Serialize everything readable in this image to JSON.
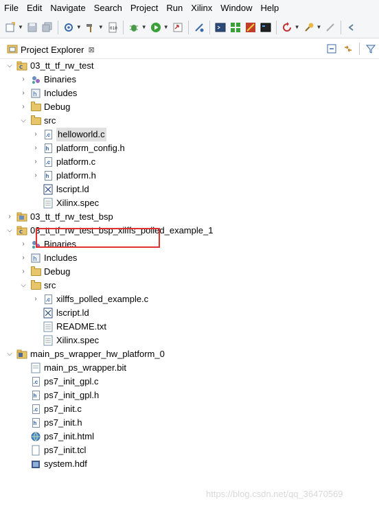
{
  "menubar": {
    "items": [
      "File",
      "Edit",
      "Navigate",
      "Search",
      "Project",
      "Run",
      "Xilinx",
      "Window",
      "Help"
    ]
  },
  "view": {
    "title": "Project Explorer",
    "close_glyph": "⊠"
  },
  "tree": {
    "project1": {
      "name": "03_tt_tf_rw_test",
      "binaries": "Binaries",
      "includes": "Includes",
      "debug": "Debug",
      "src": "src",
      "files": [
        "helloworld.c",
        "platform_config.h",
        "platform.c",
        "platform.h"
      ],
      "lscript": "lscript.ld",
      "spec": "Xilinx.spec"
    },
    "bsp": {
      "name": "03_tt_tf_rw_test_bsp"
    },
    "project2": {
      "name": "03_tt_tf_rw_test_bsp_xilffs_polled_example_1",
      "binaries": "Binaries",
      "includes": "Includes",
      "debug": "Debug",
      "src": "src",
      "example_file": "xilffs_polled_example.c",
      "lscript": "lscript.ld",
      "readme": "README.txt",
      "spec": "Xilinx.spec"
    },
    "hw_platform": {
      "name": "main_ps_wrapper_hw_platform_0",
      "files": [
        "main_ps_wrapper.bit",
        "ps7_init_gpl.c",
        "ps7_init_gpl.h",
        "ps7_init.c",
        "ps7_init.h",
        "ps7_init.html",
        "ps7_init.tcl",
        "system.hdf"
      ]
    }
  },
  "watermark": "https://blog.csdn.net/qq_36470569",
  "colors": {
    "highlight_border": "#e03030",
    "selection_bg": "#e0e0e0",
    "folder": "#e8c46a"
  }
}
